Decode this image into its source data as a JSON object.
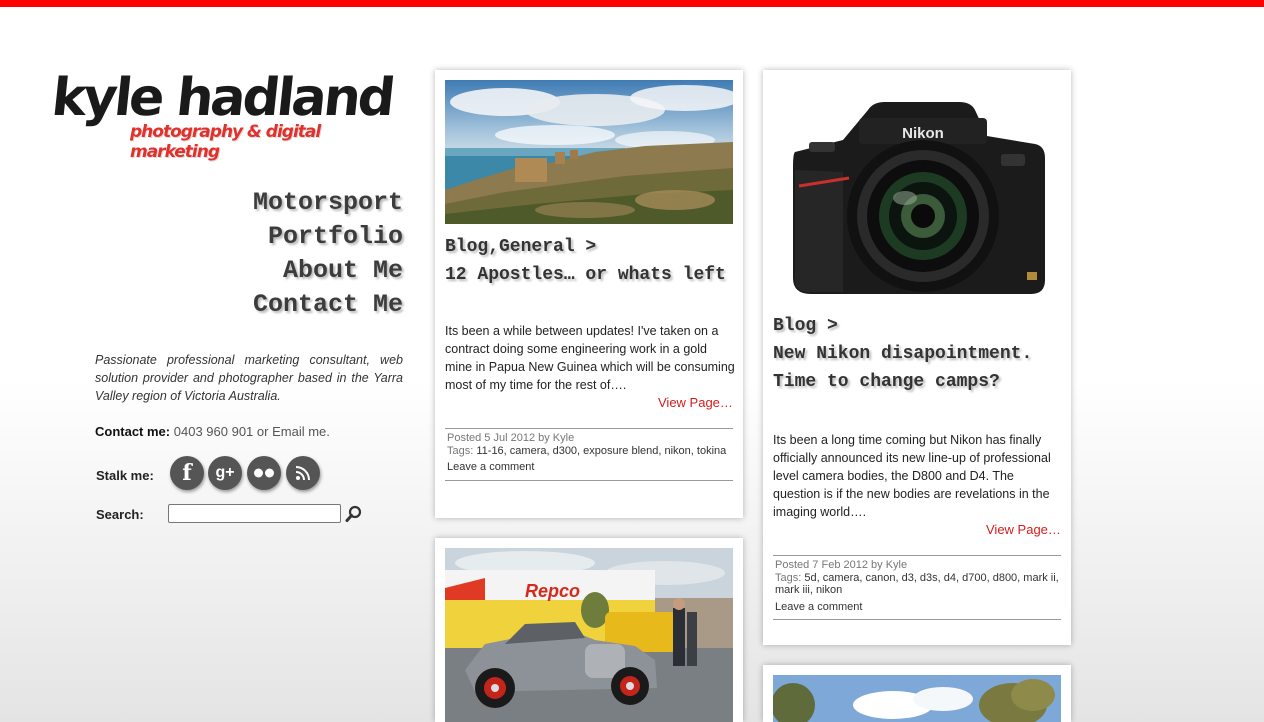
{
  "brand": {
    "name": "kyle hadland",
    "tagline": "photography & digital marketing",
    "accent_color": "#ff0000"
  },
  "nav": {
    "items": [
      {
        "label": "Motorsport"
      },
      {
        "label": "Portfolio"
      },
      {
        "label": "About Me"
      },
      {
        "label": "Contact Me"
      }
    ]
  },
  "sidebar": {
    "bio": "Passionate professional marketing consultant, web solution provider and photographer based in the Yarra Valley region of Victoria Australia.",
    "contact_label": "Contact me:",
    "contact_phone": "0403 960 901",
    "contact_or": "or",
    "contact_email": "Email me.",
    "stalk_label": "Stalk me:",
    "social_icons": [
      "facebook-icon",
      "google-plus-icon",
      "flickr-icon",
      "rss-icon"
    ],
    "search_label": "Search:",
    "search_value": ""
  },
  "posts": [
    {
      "category": "Blog,General >",
      "title": "12 Apostles… or whats left",
      "excerpt": "Its been a while between updates! I've taken on a contract doing some engineering work in a gold mine in Papua New Guinea which will be consuming most of my time for the rest of….",
      "view_page": "View Page…",
      "posted": "Posted 5 Jul 2012 by Kyle",
      "tags_label": "Tags:",
      "tags": "11-16, camera, d300, exposure blend, nikon, tokina",
      "comment": "Leave a comment"
    },
    {
      "category": "Blog >",
      "title": "New Nikon disapointment. Time to change camps?",
      "excerpt": "Its been a long time coming but Nikon has finally officially announced its new line-up of professional level camera bodies, the D800 and D4.  The question is if the new bodies are revelations in the imaging world….",
      "view_page": "View Page…",
      "posted": "Posted 7 Feb 2012 by Kyle",
      "tags_label": "Tags:",
      "tags": "5d, camera, canon, d3, d3s, d4, d700, d800, mark ii, mark iii, nikon",
      "comment": "Leave a comment",
      "camera_brand": "Nikon"
    },
    {
      "sign_text": "Repco"
    }
  ]
}
